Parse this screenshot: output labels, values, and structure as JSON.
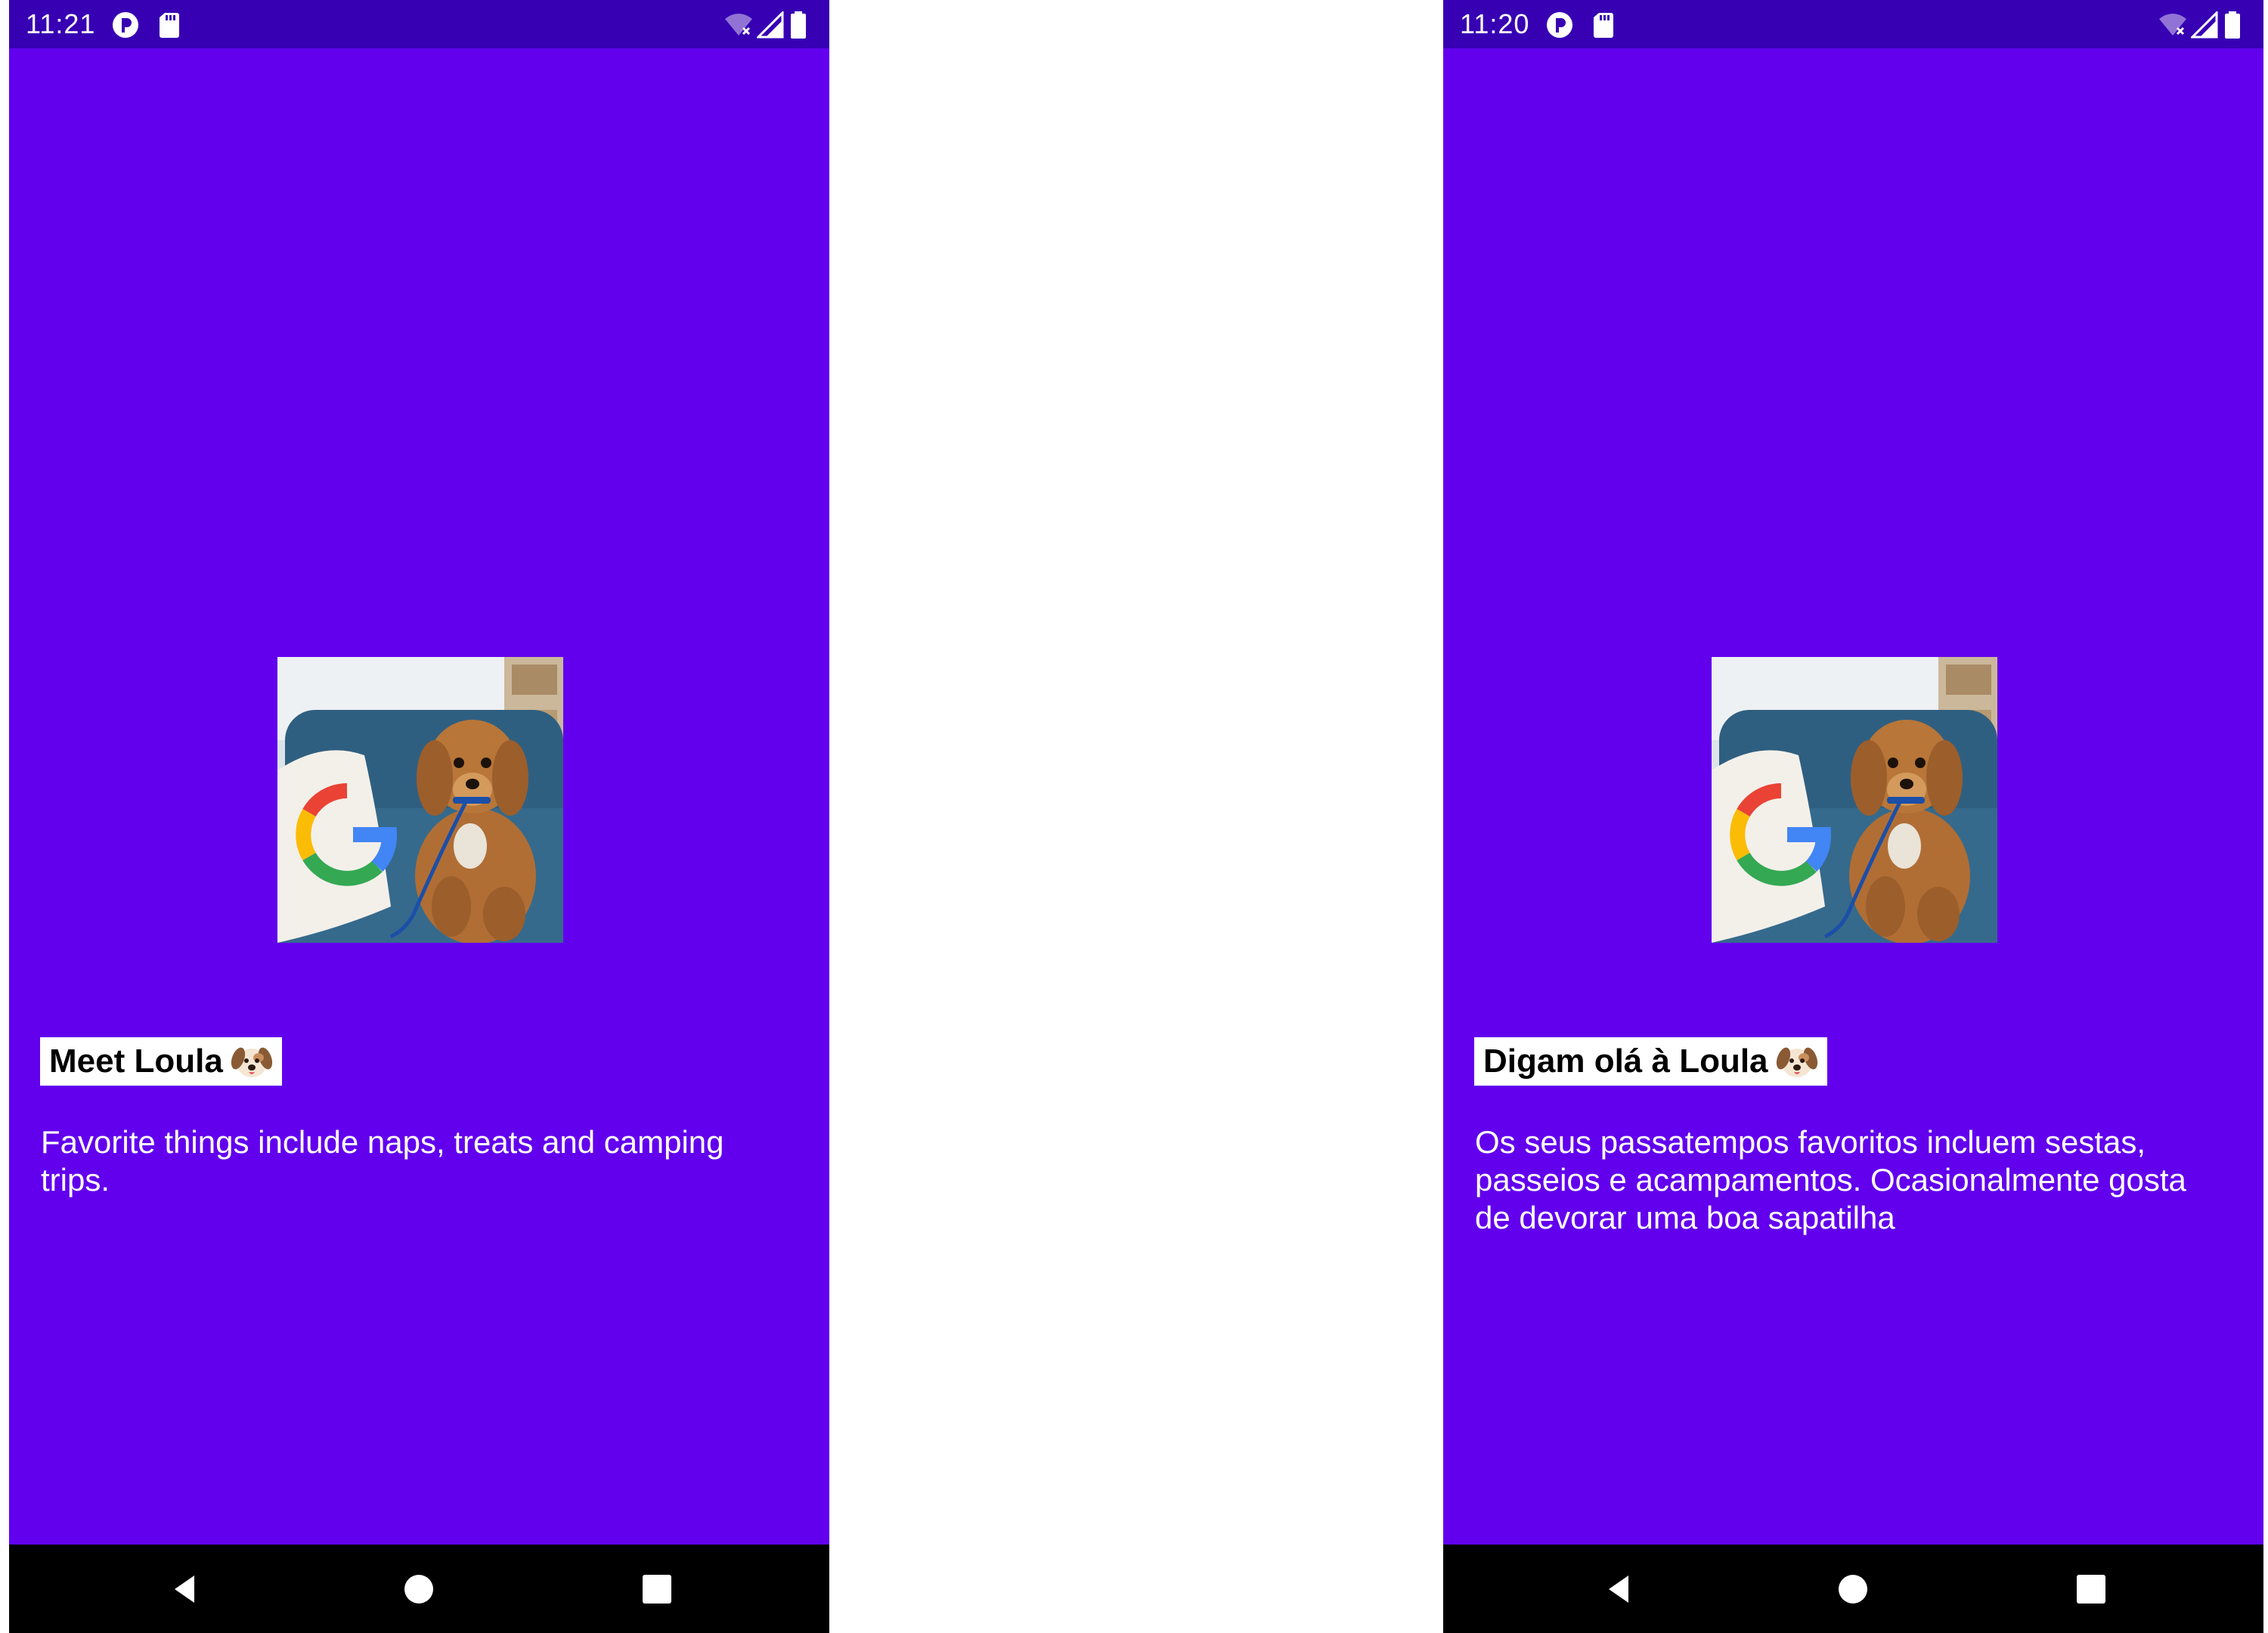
{
  "screens": [
    {
      "id": "left",
      "status_bar": {
        "time": "11:21",
        "left_icons": [
          "app-notification-icon",
          "sd-card-icon"
        ],
        "right_icons": [
          "wifi-off-icon",
          "cellular-signal-icon",
          "battery-icon"
        ]
      },
      "photo": {
        "subject": "dog-photo",
        "alt": "Loula"
      },
      "title": "Meet Loula",
      "title_emoji": "dog-face-emoji",
      "description": "Favorite things include naps, treats and camping trips.",
      "nav_bar": [
        "back-button",
        "home-button",
        "recents-button"
      ]
    },
    {
      "id": "right",
      "status_bar": {
        "time": "11:20",
        "left_icons": [
          "app-notification-icon",
          "sd-card-icon"
        ],
        "right_icons": [
          "wifi-off-icon",
          "cellular-signal-icon",
          "battery-icon"
        ]
      },
      "photo": {
        "subject": "dog-photo",
        "alt": "Loula"
      },
      "title": "Digam olá à Loula",
      "title_emoji": "dog-face-emoji",
      "description": "Os seus passatempos favoritos incluem sestas, passeios e acampamentos. Ocasionalmente gosta de devorar uma boa sapatilha",
      "nav_bar": [
        "back-button",
        "home-button",
        "recents-button"
      ]
    }
  ],
  "colors": {
    "background": "#6200ee",
    "status_bar": "#3700b3",
    "nav_bar": "#000000",
    "title_chip": "#ffffff",
    "text_on_primary": "#ffffff"
  }
}
